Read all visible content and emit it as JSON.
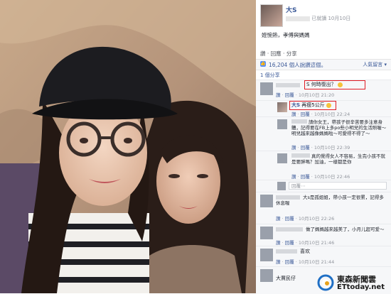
{
  "post": {
    "author": "大S",
    "visibility": "已就讀",
    "date": "10月10日",
    "caption": "姪惋熱，孝傅與媽媽",
    "actions": "讚 · 回應 · 分享",
    "likes": "16,204 個人說讚這個。",
    "sort": "人氣留言",
    "shares": "1 個分享"
  },
  "comments": [
    {
      "text": "S 何時復出？",
      "meta": [
        "讚",
        "回覆",
        "10月10日 21:20"
      ]
    },
    {
      "name": "大S",
      "text": "再瘦5公斤",
      "meta": [
        "讚",
        "回覆",
        "10月10日 22:24"
      ]
    },
    {
      "text": "請你女王，帶孩子很辛苦要多注意身體，記得要在FB上多po些小明兒的生活照喔～明兒越來越像媽媽啦～可愛得不得了～",
      "meta": [
        "讚",
        "回覆",
        "10月10日 22:39"
      ]
    },
    {
      "text": "真的覺得女人不容易，生完小孩不就是要胖嗎？加油，一樣都是你",
      "meta": [
        "讚",
        "回覆",
        "10月10日 22:46"
      ]
    },
    {
      "reply_placeholder": "回覆⋯"
    },
    {
      "text": "大s是孤姐姐，帶小孩一定很累，記得多休息喔",
      "meta": [
        "讚",
        "回覆",
        "10月10日 22:26"
      ]
    },
    {
      "text": "做了媽媽越來越美了，小月儿超可爱～",
      "meta": [
        "讚",
        "回覆",
        "10月10日 21:46"
      ]
    },
    {
      "text": "喜欢",
      "meta": [
        "讚",
        "回覆",
        "10月10日 21:44"
      ]
    },
    {
      "text": "大賈民仔",
      "meta": []
    }
  ],
  "watermark": {
    "line1": "東森新聞雲",
    "line2": "ETtoday.net"
  },
  "colors": {
    "link": "#3b5998",
    "highlight": "#e01b24",
    "panel": "#f6f7f9"
  }
}
